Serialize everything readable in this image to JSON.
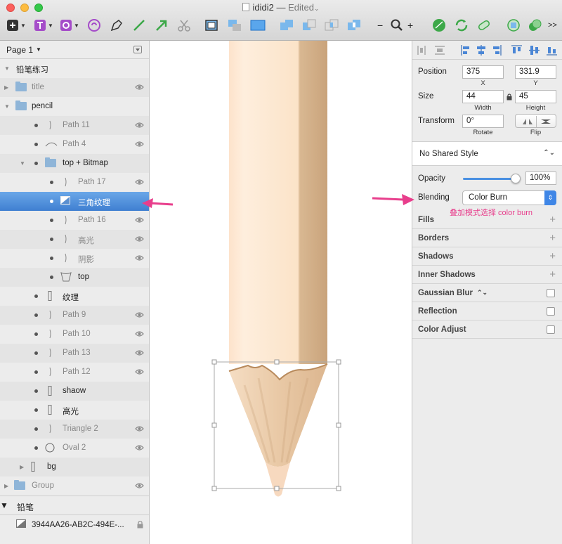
{
  "window": {
    "title": "ididi2",
    "separator": "—",
    "status": "Edited"
  },
  "toolbar": {
    "zoom_minus": "−",
    "zoom_plus": "+",
    "more": ">>"
  },
  "layers": {
    "page_label": "Page 1",
    "rows": [
      {
        "name": "铅笔练习",
        "indent": 0,
        "kind": "artboard",
        "expanded": true
      },
      {
        "name": "title",
        "indent": 1,
        "kind": "folder",
        "expanded": false,
        "muted": true,
        "eye": true
      },
      {
        "name": "pencil",
        "indent": 1,
        "kind": "folder",
        "expanded": true
      },
      {
        "name": "Path 11",
        "indent": 2,
        "kind": "path",
        "muted": true,
        "eye": true
      },
      {
        "name": "Path 4",
        "indent": 2,
        "kind": "curve",
        "muted": true,
        "eye": true
      },
      {
        "name": "top + Bitmap",
        "indent": 2,
        "kind": "folder",
        "expanded": true
      },
      {
        "name": "Path 17",
        "indent": 3,
        "kind": "path",
        "muted": true,
        "eye": true
      },
      {
        "name": "三角纹理",
        "indent": 3,
        "kind": "bitmap",
        "selected": true
      },
      {
        "name": "Path 16",
        "indent": 3,
        "kind": "path",
        "muted": true,
        "eye": true
      },
      {
        "name": "高光",
        "indent": 3,
        "kind": "path",
        "muted": true,
        "eye": true
      },
      {
        "name": "阴影",
        "indent": 3,
        "kind": "path",
        "muted": true,
        "eye": true
      },
      {
        "name": "top",
        "indent": 3,
        "kind": "shape"
      },
      {
        "name": "纹理",
        "indent": 2,
        "kind": "rect"
      },
      {
        "name": "Path 9",
        "indent": 2,
        "kind": "path",
        "muted": true,
        "eye": true
      },
      {
        "name": "Path 10",
        "indent": 2,
        "kind": "path",
        "muted": true,
        "eye": true
      },
      {
        "name": "Path 13",
        "indent": 2,
        "kind": "path",
        "muted": true,
        "eye": true
      },
      {
        "name": "Path 12",
        "indent": 2,
        "kind": "path",
        "muted": true,
        "eye": true
      },
      {
        "name": "shaow",
        "indent": 2,
        "kind": "rect"
      },
      {
        "name": "高光",
        "indent": 2,
        "kind": "rect"
      },
      {
        "name": "Triangle 2",
        "indent": 2,
        "kind": "path",
        "muted": true,
        "eye": true
      },
      {
        "name": "Oval 2",
        "indent": 2,
        "kind": "oval",
        "muted": true,
        "eye": true
      },
      {
        "name": "bg",
        "indent": 1,
        "kind": "rect",
        "expanded": false
      },
      {
        "name": "Group",
        "indent": 0,
        "kind": "folder",
        "expanded": false,
        "muted": true,
        "eye": true
      }
    ],
    "section_2": {
      "name": "铅笔"
    },
    "symbol_row": {
      "name": "3944AA26-AB2C-494E-..."
    }
  },
  "inspector": {
    "position": {
      "label": "Position",
      "x": "375",
      "y": "331.9",
      "x_label": "X",
      "y_label": "Y"
    },
    "size": {
      "label": "Size",
      "width": "44",
      "height": "45",
      "width_label": "Width",
      "height_label": "Height"
    },
    "transform": {
      "label": "Transform",
      "rotate": "0°",
      "rotate_label": "Rotate",
      "flip_label": "Flip"
    },
    "shared_style": "No Shared Style",
    "opacity": {
      "label": "Opacity",
      "value": "100%",
      "level": 1.0
    },
    "blending": {
      "label": "Blending",
      "value": "Color Burn"
    },
    "props": [
      {
        "name": "Fills",
        "control": "plus"
      },
      {
        "name": "Borders",
        "control": "plus"
      },
      {
        "name": "Shadows",
        "control": "plus"
      },
      {
        "name": "Inner Shadows",
        "control": "plus"
      },
      {
        "name": "Gaussian Blur",
        "control": "checkbox"
      },
      {
        "name": "Reflection",
        "control": "checkbox"
      },
      {
        "name": "Color Adjust",
        "control": "checkbox"
      }
    ],
    "gaussian_updown": "⌃"
  },
  "annotation": {
    "text": "叠加模式选择 color burn",
    "color": "#e83e8c"
  },
  "colors": {
    "selection": "#3f7fd1",
    "accent": "#3f86e6",
    "folder": "#8fb5d8",
    "pencil_body_light": "#fde6cf",
    "pencil_body_dark": "#d2ac85",
    "pencil_tip": "#edd0b0"
  }
}
